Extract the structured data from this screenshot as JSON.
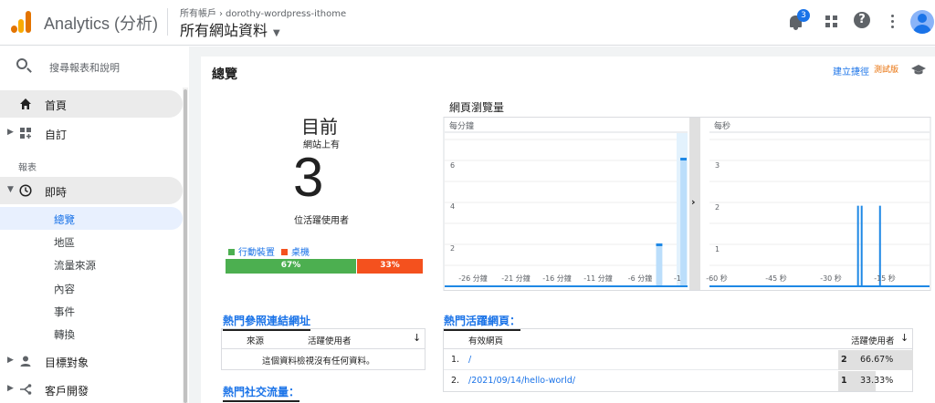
{
  "app": {
    "name": "Analytics (分析)"
  },
  "breadcrumb": {
    "account": "所有帳戶",
    "property": "dorothy-wordpress-ithome"
  },
  "view": {
    "label": "所有網站資料"
  },
  "notifications": {
    "count": "3"
  },
  "sidebar": {
    "search_label": "搜尋報表和說明",
    "home": "首頁",
    "custom": "自訂",
    "reports_label": "報表",
    "realtime": "即時",
    "realtime_items": [
      "總覽",
      "地區",
      "流量來源",
      "內容",
      "事件",
      "轉換"
    ],
    "audience": "目標對象",
    "acquisition": "客戶開發"
  },
  "main": {
    "title": "總覽",
    "shortcut": "建立捷徑",
    "beta": "測試版",
    "now": "目前",
    "now_sub": "網站上有",
    "active_users": "3",
    "active_label": "位活躍使用者",
    "device_legend": [
      {
        "label": "行動裝置",
        "color": "#4caf50"
      },
      {
        "label": "桌機",
        "color": "#f4511e"
      }
    ],
    "device_split": [
      "67%",
      "33%"
    ]
  },
  "chart_data": [
    {
      "type": "bar",
      "title": "網頁瀏覽量",
      "panel_label": "每分鐘",
      "x_ticks": [
        "-26 分鐘",
        "-21 分鐘",
        "-16 分鐘",
        "-11 分鐘",
        "-6 分鐘",
        "-1"
      ],
      "y_ticks": [
        "6",
        "4",
        "2"
      ],
      "ylim": [
        0,
        6
      ],
      "values": [
        0,
        0,
        0,
        0,
        0,
        0,
        0,
        0,
        0,
        0,
        0,
        0,
        0,
        0,
        0,
        0,
        0,
        0,
        0,
        0,
        0,
        0,
        0,
        0,
        0,
        0,
        2,
        0,
        0,
        6
      ]
    },
    {
      "type": "bar",
      "panel_label": "每秒",
      "x_ticks": [
        "-60 秒",
        "-45 秒",
        "-30 秒",
        "-15 秒"
      ],
      "y_ticks": [
        "3",
        "2",
        "1"
      ],
      "ylim": [
        0,
        3
      ],
      "values": [
        0,
        0,
        0,
        0,
        0,
        0,
        0,
        0,
        0,
        0,
        0,
        0,
        0,
        0,
        0,
        0,
        0,
        0,
        0,
        0,
        0,
        0,
        0,
        0,
        0,
        0,
        0,
        0,
        0,
        0,
        0,
        0,
        0,
        0,
        0,
        0,
        0,
        0,
        0,
        0,
        2,
        2,
        0,
        0,
        0,
        0,
        2,
        0,
        0,
        0,
        0,
        0,
        0,
        0,
        0,
        0,
        0,
        0,
        0,
        0
      ]
    }
  ],
  "referrals": {
    "title": "熱門參照連結網址",
    "col_source": "來源",
    "col_users": "活躍使用者",
    "empty": "這個資料檢視沒有任何資料。"
  },
  "social": {
    "title": "熱門社交流量："
  },
  "pages": {
    "title": "熱門活躍網頁：",
    "col_page": "有效網頁",
    "col_users": "活躍使用者",
    "rows": [
      {
        "idx": "1.",
        "page": "/",
        "users": "2",
        "pct": "66.67%"
      },
      {
        "idx": "2.",
        "page": "/2021/09/14/hello-world/",
        "users": "1",
        "pct": "33.33%"
      }
    ]
  }
}
